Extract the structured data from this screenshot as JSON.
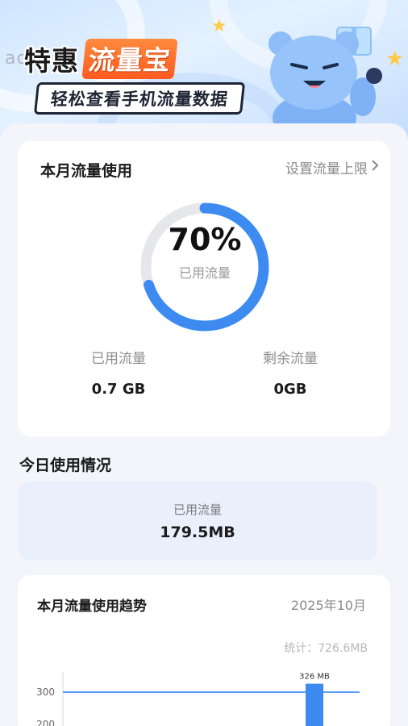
{
  "banner": {
    "watermark": "ac",
    "title_part1": "特惠",
    "title_part2": "流量宝",
    "subtitle": "轻松查看手机流量数据"
  },
  "month_usage": {
    "title": "本月流量使用",
    "limit_link": "设置流量上限",
    "percent_text": "70%",
    "percent_value": 0.7,
    "ring_label": "已用流量",
    "used_label": "已用流量",
    "used_value": "0.7 GB",
    "remaining_label": "剩余流量",
    "remaining_value": "0GB",
    "colors": {
      "ring": "#3d8bf0",
      "track": "#e6e7eb"
    }
  },
  "today": {
    "section_title": "今日使用情况",
    "label": "已用流量",
    "value": "179.5MB"
  },
  "trend": {
    "title": "本月流量使用趋势",
    "month": "2025年10月",
    "total": "统计：726.6MB"
  },
  "chart_data": {
    "type": "bar",
    "y_ticks": [
      300,
      200
    ],
    "bars": [
      {
        "label": "326 MB",
        "value": 326
      }
    ],
    "reference_line": 300,
    "colors": {
      "bar": "#3d8bf0",
      "line": "#5aa0f5"
    }
  }
}
